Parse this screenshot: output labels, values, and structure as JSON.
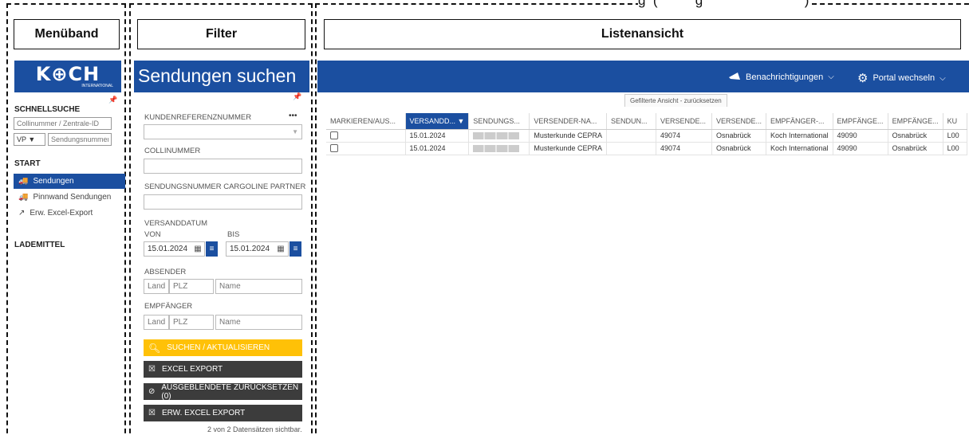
{
  "annotations": {
    "menu_label": "Menüband",
    "filter_label": "Filter",
    "list_label": "Listenansicht",
    "top_partial": "g  (          g                           )"
  },
  "brand": {
    "logo_text": "K⊕CH",
    "logo_sub": "INTERNATIONAL"
  },
  "header": {
    "title": "Sendungen suchen",
    "notifications": "Benachrichtigungen",
    "portal": "Portal wechseln"
  },
  "sidebar": {
    "quick_search_heading": "SCHNELLSUCHE",
    "colli_placeholder": "Collinummer / Zentrale-ID",
    "select_value": "VP",
    "shipment_placeholder": "Sendungsnummer",
    "start_heading": "START",
    "items": [
      {
        "label": "Sendungen",
        "icon": "truck-icon"
      },
      {
        "label": "Pinnwand Sendungen",
        "icon": "truck-icon"
      },
      {
        "label": "Erw. Excel-Export",
        "icon": "export-icon"
      }
    ],
    "lademittel_heading": "LADEMITTEL"
  },
  "filter": {
    "customer_ref_label": "KUNDENREFERENZNUMMER",
    "more": "•••",
    "colli_label": "COLLINUMMER",
    "cargoline_label": "SENDUNGSNUMMER CARGOLINE PARTNER",
    "date_label": "VERSANDDATUM",
    "from_label": "VON",
    "to_label": "BIS",
    "date_from": "15.01.2024",
    "date_to": "15.01.2024",
    "sender_label": "ABSENDER",
    "recipient_label": "EMPFÄNGER",
    "country_placeholder": "Land",
    "zip_placeholder": "PLZ",
    "name_placeholder": "Name",
    "search_button": "SUCHEN / AKTUALISIEREN",
    "excel_button": "EXCEL EXPORT",
    "reset_hidden_button": "AUSGEBLENDETE ZURÜCKSETZEN (0)",
    "ext_excel_button": "ERW. EXCEL EXPORT",
    "record_count": "2 von 2 Datensätzen sichtbar."
  },
  "list": {
    "filtered_view_tab": "Gefilterte Ansicht - zurücksetzen",
    "columns": [
      "MARKIEREN/AUS...",
      "VERSANDD... ▼",
      "SENDUNGS...",
      "VERSENDER-NA...",
      "SENDUN...",
      "VERSENDE...",
      "VERSENDE...",
      "EMPFÄNGER-...",
      "EMPFÄNGE...",
      "EMPFÄNGE...",
      "KU"
    ],
    "rows": [
      [
        "",
        "15.01.2024",
        "",
        "Musterkunde CEPRA",
        "",
        "49074",
        "Osnabrück",
        "Koch International",
        "49090",
        "Osnabrück",
        "L00"
      ],
      [
        "",
        "15.01.2024",
        "",
        "Musterkunde CEPRA",
        "",
        "49074",
        "Osnabrück",
        "Koch International",
        "49090",
        "Osnabrück",
        "L00"
      ]
    ]
  },
  "colors": {
    "brand_blue": "#1b4fa0",
    "accent_yellow": "#ffc107",
    "dark_button": "#3c3c3c"
  }
}
